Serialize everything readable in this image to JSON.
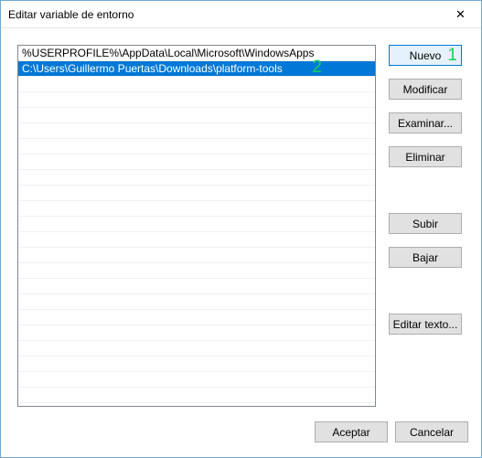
{
  "window": {
    "title": "Editar variable de entorno"
  },
  "list": {
    "items": [
      "%USERPROFILE%\\AppData\\Local\\Microsoft\\WindowsApps",
      "C:\\Users\\Guillermo Puertas\\Downloads\\platform-tools"
    ],
    "selectedIndex": 1
  },
  "annotations": {
    "one": "1",
    "two": "2"
  },
  "buttons": {
    "nuevo": "Nuevo",
    "modificar": "Modificar",
    "examinar": "Examinar...",
    "eliminar": "Eliminar",
    "subir": "Subir",
    "bajar": "Bajar",
    "editar_texto": "Editar texto...",
    "aceptar": "Aceptar",
    "cancelar": "Cancelar"
  }
}
